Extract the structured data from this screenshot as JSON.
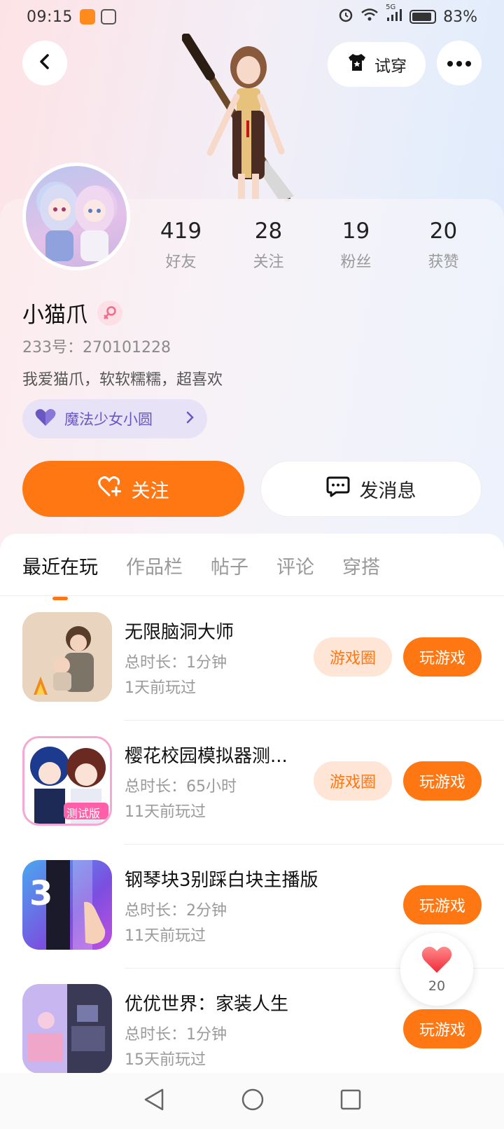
{
  "status_bar": {
    "time": "09:15",
    "battery": "83%",
    "network": "5G"
  },
  "header": {
    "try_on_label": "试穿"
  },
  "profile": {
    "stats": [
      {
        "value": "419",
        "label": "好友"
      },
      {
        "value": "28",
        "label": "关注"
      },
      {
        "value": "19",
        "label": "粉丝"
      },
      {
        "value": "20",
        "label": "获赞"
      }
    ],
    "name": "小猫爪",
    "uid": "233号：270101228",
    "bio": "我爱猫爪，软软糯糯，超喜欢",
    "circle_tag": "魔法少女小圆"
  },
  "actions": {
    "follow_label": "关注",
    "message_label": "发消息"
  },
  "tabs": [
    {
      "label": "最近在玩",
      "active": true
    },
    {
      "label": "作品栏",
      "active": false
    },
    {
      "label": "帖子",
      "active": false
    },
    {
      "label": "评论",
      "active": false
    },
    {
      "label": "穿搭",
      "active": false
    }
  ],
  "games": [
    {
      "title": "无限脑洞大师",
      "duration": "总时长：1分钟",
      "last_played": "1天前玩过",
      "circle_label": "游戏圈",
      "play_label": "玩游戏"
    },
    {
      "title": "樱花校园模拟器测...",
      "duration": "总时长：65小时",
      "last_played": "11天前玩过",
      "circle_label": "游戏圈",
      "play_label": "玩游戏"
    },
    {
      "title": "钢琴块3别踩白块主播版",
      "duration": "总时长：2分钟",
      "last_played": "11天前玩过",
      "play_label": "玩游戏"
    },
    {
      "title": "优优世界：家装人生",
      "duration": "总时长：1分钟",
      "last_played": "15天前玩过",
      "play_label": "玩游戏"
    }
  ],
  "game_icon_labels": {
    "piano": "3",
    "sakura": "测试版"
  },
  "like_float": {
    "count": "20"
  },
  "colors": {
    "accent": "#ff7713",
    "accent_light": "#fee5d6",
    "tag_purple": "#6a57c2"
  }
}
